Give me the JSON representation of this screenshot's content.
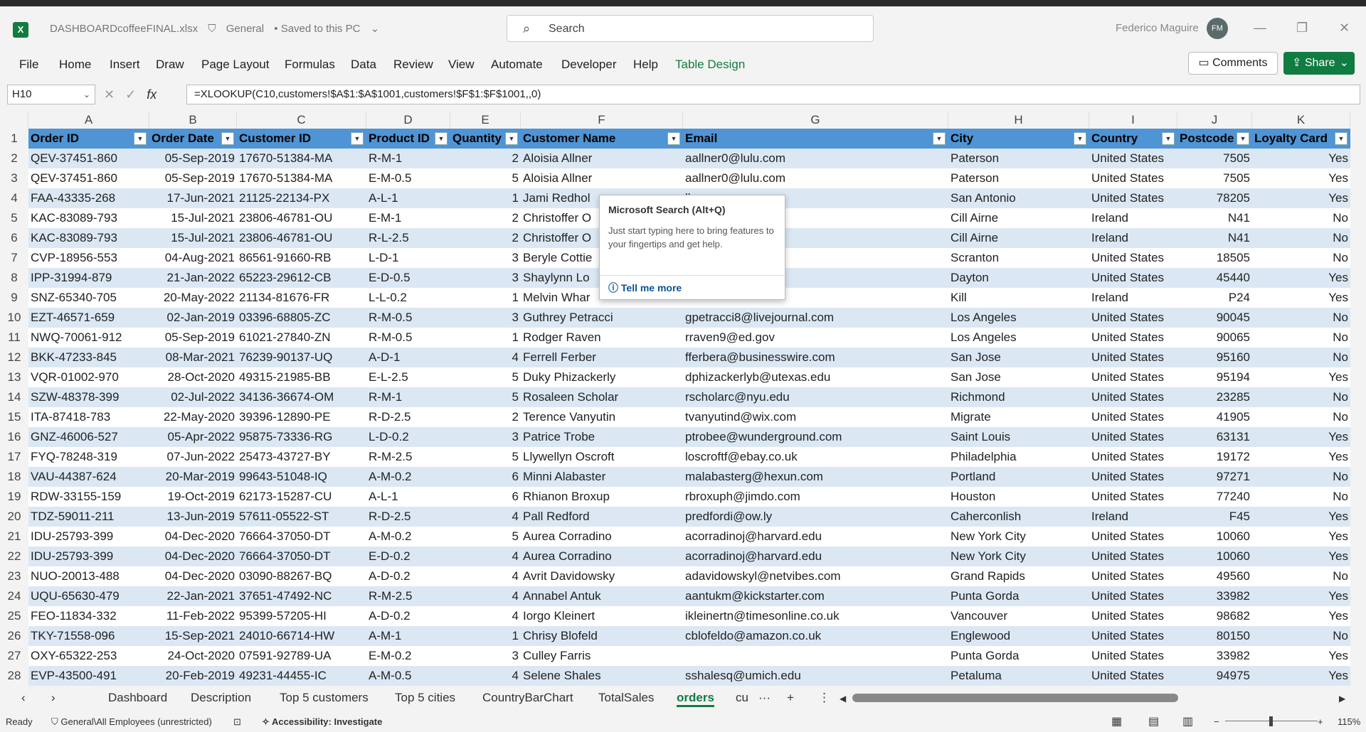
{
  "titlebar": {
    "app_icon": "excel-icon",
    "filename": "DASHBOARDcoffeeFINAL.xlsx",
    "sensitivity": "General",
    "save_state": "• Saved to this PC",
    "search_placeholder": "Search",
    "user_name": "Federico Maguire",
    "user_initials": "FM"
  },
  "menu": {
    "items": [
      "File",
      "Home",
      "Insert",
      "Draw",
      "Page Layout",
      "Formulas",
      "Data",
      "Review",
      "View",
      "Automate",
      "Developer",
      "Help",
      "Table Design"
    ],
    "comments": "Comments",
    "share": "Share"
  },
  "formula_bar": {
    "cell_ref": "H10",
    "formula": "=XLOOKUP(C10,customers!$A$1:$A$1001,customers!$F$1:$F$1001,,0)"
  },
  "sheet": {
    "column_letters": [
      "A",
      "B",
      "C",
      "D",
      "E",
      "F",
      "G",
      "H",
      "I",
      "J",
      "K"
    ],
    "headers": [
      "Order ID",
      "Order Date",
      "Customer ID",
      "Product ID",
      "Quantity",
      "Customer Name",
      "Email",
      "City",
      "Country",
      "Postcode",
      "Loyalty Card"
    ],
    "rows": [
      [
        "QEV-37451-860",
        "05-Sep-2019",
        "17670-51384-MA",
        "R-M-1",
        "2",
        "Aloisia Allner",
        "aallner0@lulu.com",
        "Paterson",
        "United States",
        "7505",
        "Yes"
      ],
      [
        "QEV-37451-860",
        "05-Sep-2019",
        "17670-51384-MA",
        "E-M-0.5",
        "5",
        "Aloisia Allner",
        "aallner0@lulu.com",
        "Paterson",
        "United States",
        "7505",
        "Yes"
      ],
      [
        "FAA-43335-268",
        "17-Jun-2021",
        "21125-22134-PX",
        "A-L-1",
        "1",
        "Jami Redhol",
        "ll.com",
        "San Antonio",
        "United States",
        "78205",
        "Yes"
      ],
      [
        "KAC-83089-793",
        "15-Jul-2021",
        "23806-46781-OU",
        "E-M-1",
        "2",
        "Christoffer O",
        "",
        "Cill Airne",
        "Ireland",
        "N41",
        "No"
      ],
      [
        "KAC-83089-793",
        "15-Jul-2021",
        "23806-46781-OU",
        "R-L-2.5",
        "2",
        "Christoffer O",
        "",
        "Cill Airne",
        "Ireland",
        "N41",
        "No"
      ],
      [
        "CVP-18956-553",
        "04-Aug-2021",
        "86561-91660-RB",
        "L-D-1",
        "3",
        "Beryle Cottie",
        "",
        "Scranton",
        "United States",
        "18505",
        "No"
      ],
      [
        "IPP-31994-879",
        "21-Jan-2022",
        "65223-29612-CB",
        "E-D-0.5",
        "3",
        "Shaylynn Lo",
        "m",
        "Dayton",
        "United States",
        "45440",
        "Yes"
      ],
      [
        "SNZ-65340-705",
        "20-May-2022",
        "21134-81676-FR",
        "L-L-0.2",
        "1",
        "Melvin Whar",
        "",
        "Kill",
        "Ireland",
        "P24",
        "Yes"
      ],
      [
        "EZT-46571-659",
        "02-Jan-2019",
        "03396-68805-ZC",
        "R-M-0.5",
        "3",
        "Guthrey Petracci",
        "gpetracci8@livejournal.com",
        "Los Angeles",
        "United States",
        "90045",
        "No"
      ],
      [
        "NWQ-70061-912",
        "05-Sep-2019",
        "61021-27840-ZN",
        "R-M-0.5",
        "1",
        "Rodger Raven",
        "rraven9@ed.gov",
        "Los Angeles",
        "United States",
        "90065",
        "No"
      ],
      [
        "BKK-47233-845",
        "08-Mar-2021",
        "76239-90137-UQ",
        "A-D-1",
        "4",
        "Ferrell Ferber",
        "fferbera@businesswire.com",
        "San Jose",
        "United States",
        "95160",
        "No"
      ],
      [
        "VQR-01002-970",
        "28-Oct-2020",
        "49315-21985-BB",
        "E-L-2.5",
        "5",
        "Duky Phizackerly",
        "dphizackerlyb@utexas.edu",
        "San Jose",
        "United States",
        "95194",
        "Yes"
      ],
      [
        "SZW-48378-399",
        "02-Jul-2022",
        "34136-36674-OM",
        "R-M-1",
        "5",
        "Rosaleen Scholar",
        "rscholarc@nyu.edu",
        "Richmond",
        "United States",
        "23285",
        "No"
      ],
      [
        "ITA-87418-783",
        "22-May-2020",
        "39396-12890-PE",
        "R-D-2.5",
        "2",
        "Terence Vanyutin",
        "tvanyutind@wix.com",
        "Migrate",
        "United States",
        "41905",
        "No"
      ],
      [
        "GNZ-46006-527",
        "05-Apr-2022",
        "95875-73336-RG",
        "L-D-0.2",
        "3",
        "Patrice Trobe",
        "ptrobee@wunderground.com",
        "Saint Louis",
        "United States",
        "63131",
        "Yes"
      ],
      [
        "FYQ-78248-319",
        "07-Jun-2022",
        "25473-43727-BY",
        "R-M-2.5",
        "5",
        "Llywellyn Oscroft",
        "loscroftf@ebay.co.uk",
        "Philadelphia",
        "United States",
        "19172",
        "Yes"
      ],
      [
        "VAU-44387-624",
        "20-Mar-2019",
        "99643-51048-IQ",
        "A-M-0.2",
        "6",
        "Minni Alabaster",
        "malabasterg@hexun.com",
        "Portland",
        "United States",
        "97271",
        "No"
      ],
      [
        "RDW-33155-159",
        "19-Oct-2019",
        "62173-15287-CU",
        "A-L-1",
        "6",
        "Rhianon Broxup",
        "rbroxuph@jimdo.com",
        "Houston",
        "United States",
        "77240",
        "No"
      ],
      [
        "TDZ-59011-211",
        "13-Jun-2019",
        "57611-05522-ST",
        "R-D-2.5",
        "4",
        "Pall Redford",
        "predfordi@ow.ly",
        "Caherconlish",
        "Ireland",
        "F45",
        "Yes"
      ],
      [
        "IDU-25793-399",
        "04-Dec-2020",
        "76664-37050-DT",
        "A-M-0.2",
        "5",
        "Aurea Corradino",
        "acorradinoj@harvard.edu",
        "New York City",
        "United States",
        "10060",
        "Yes"
      ],
      [
        "IDU-25793-399",
        "04-Dec-2020",
        "76664-37050-DT",
        "E-D-0.2",
        "4",
        "Aurea Corradino",
        "acorradinoj@harvard.edu",
        "New York City",
        "United States",
        "10060",
        "Yes"
      ],
      [
        "NUO-20013-488",
        "04-Dec-2020",
        "03090-88267-BQ",
        "A-D-0.2",
        "4",
        "Avrit Davidowsky",
        "adavidowskyl@netvibes.com",
        "Grand Rapids",
        "United States",
        "49560",
        "No"
      ],
      [
        "UQU-65630-479",
        "22-Jan-2021",
        "37651-47492-NC",
        "R-M-2.5",
        "4",
        "Annabel Antuk",
        "aantukm@kickstarter.com",
        "Punta Gorda",
        "United States",
        "33982",
        "Yes"
      ],
      [
        "FEO-11834-332",
        "11-Feb-2022",
        "95399-57205-HI",
        "A-D-0.2",
        "4",
        "Iorgo Kleinert",
        "ikleinertn@timesonline.co.uk",
        "Vancouver",
        "United States",
        "98682",
        "Yes"
      ],
      [
        "TKY-71558-096",
        "15-Sep-2021",
        "24010-66714-HW",
        "A-M-1",
        "1",
        "Chrisy Blofeld",
        "cblofeldo@amazon.co.uk",
        "Englewood",
        "United States",
        "80150",
        "No"
      ],
      [
        "OXY-65322-253",
        "24-Oct-2020",
        "07591-92789-UA",
        "E-M-0.2",
        "3",
        "Culley Farris",
        "",
        "Punta Gorda",
        "United States",
        "33982",
        "Yes"
      ],
      [
        "EVP-43500-491",
        "20-Feb-2019",
        "49231-44455-IC",
        "A-M-0.5",
        "4",
        "Selene Shales",
        "sshalesq@umich.edu",
        "Petaluma",
        "United States",
        "94975",
        "Yes"
      ]
    ]
  },
  "tooltip": {
    "title": "Microsoft Search (Alt+Q)",
    "body": "Just start typing here to bring features to your fingertips and get help.",
    "link": "Tell me more"
  },
  "tabs": [
    "Dashboard",
    "Description",
    "Top 5 customers",
    "Top 5 cities",
    "CountryBarChart",
    "TotalSales",
    "orders",
    "cu"
  ],
  "active_tab": "orders",
  "status": {
    "ready": "Ready",
    "sensitivity": "General\\All Employees (unrestricted)",
    "accessibility": "Accessibility: Investigate",
    "zoom": "115%"
  },
  "colors": {
    "accent": "#107c41",
    "header_fill": "#4f94d4",
    "band_fill": "#dbe8f4"
  }
}
